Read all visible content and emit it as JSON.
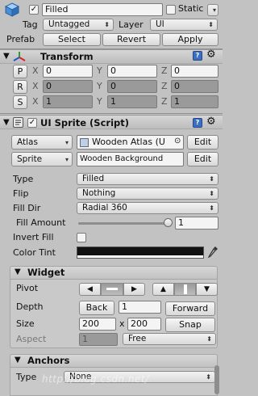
{
  "header": {
    "object_name": "Filled",
    "static_label": "Static",
    "tag_label": "Tag",
    "tag_value": "Untagged",
    "layer_label": "Layer",
    "layer_value": "UI",
    "prefab_label": "Prefab",
    "select_label": "Select",
    "revert_label": "Revert",
    "apply_label": "Apply"
  },
  "transform": {
    "title": "Transform",
    "rows": [
      {
        "btn": "P",
        "x": "0",
        "y": "0",
        "z": "0"
      },
      {
        "btn": "R",
        "x": "0",
        "y": "0",
        "z": "0"
      },
      {
        "btn": "S",
        "x": "1",
        "y": "1",
        "z": "1"
      }
    ],
    "axis_x": "X",
    "axis_y": "Y",
    "axis_z": "Z"
  },
  "sprite": {
    "title": "UI Sprite (Script)",
    "atlas_label": "Atlas",
    "atlas_value": "Wooden Atlas (U",
    "sprite_label": "Sprite",
    "sprite_value": "Wooden Background",
    "edit_label": "Edit",
    "type_label": "Type",
    "type_value": "Filled",
    "flip_label": "Flip",
    "flip_value": "Nothing",
    "fill_dir_label": "Fill Dir",
    "fill_dir_value": "Radial 360",
    "fill_amount_label": "Fill Amount",
    "fill_amount_value": "1",
    "fill_amount_level": 1,
    "invert_fill_label": "Invert Fill",
    "color_tint_label": "Color Tint",
    "color_tint": "#111111"
  },
  "widget": {
    "title": "Widget",
    "pivot_label": "Pivot",
    "depth_label": "Depth",
    "back_label": "Back",
    "depth_value": "1",
    "forward_label": "Forward",
    "size_label": "Size",
    "size_w": "200",
    "size_x": "x",
    "size_h": "200",
    "snap_label": "Snap",
    "aspect_label": "Aspect",
    "aspect_value": "1",
    "aspect_mode": "Free"
  },
  "anchors": {
    "title": "Anchors",
    "type_label": "Type",
    "type_value": "None"
  },
  "watermark": "http://blog.csdn.net/"
}
